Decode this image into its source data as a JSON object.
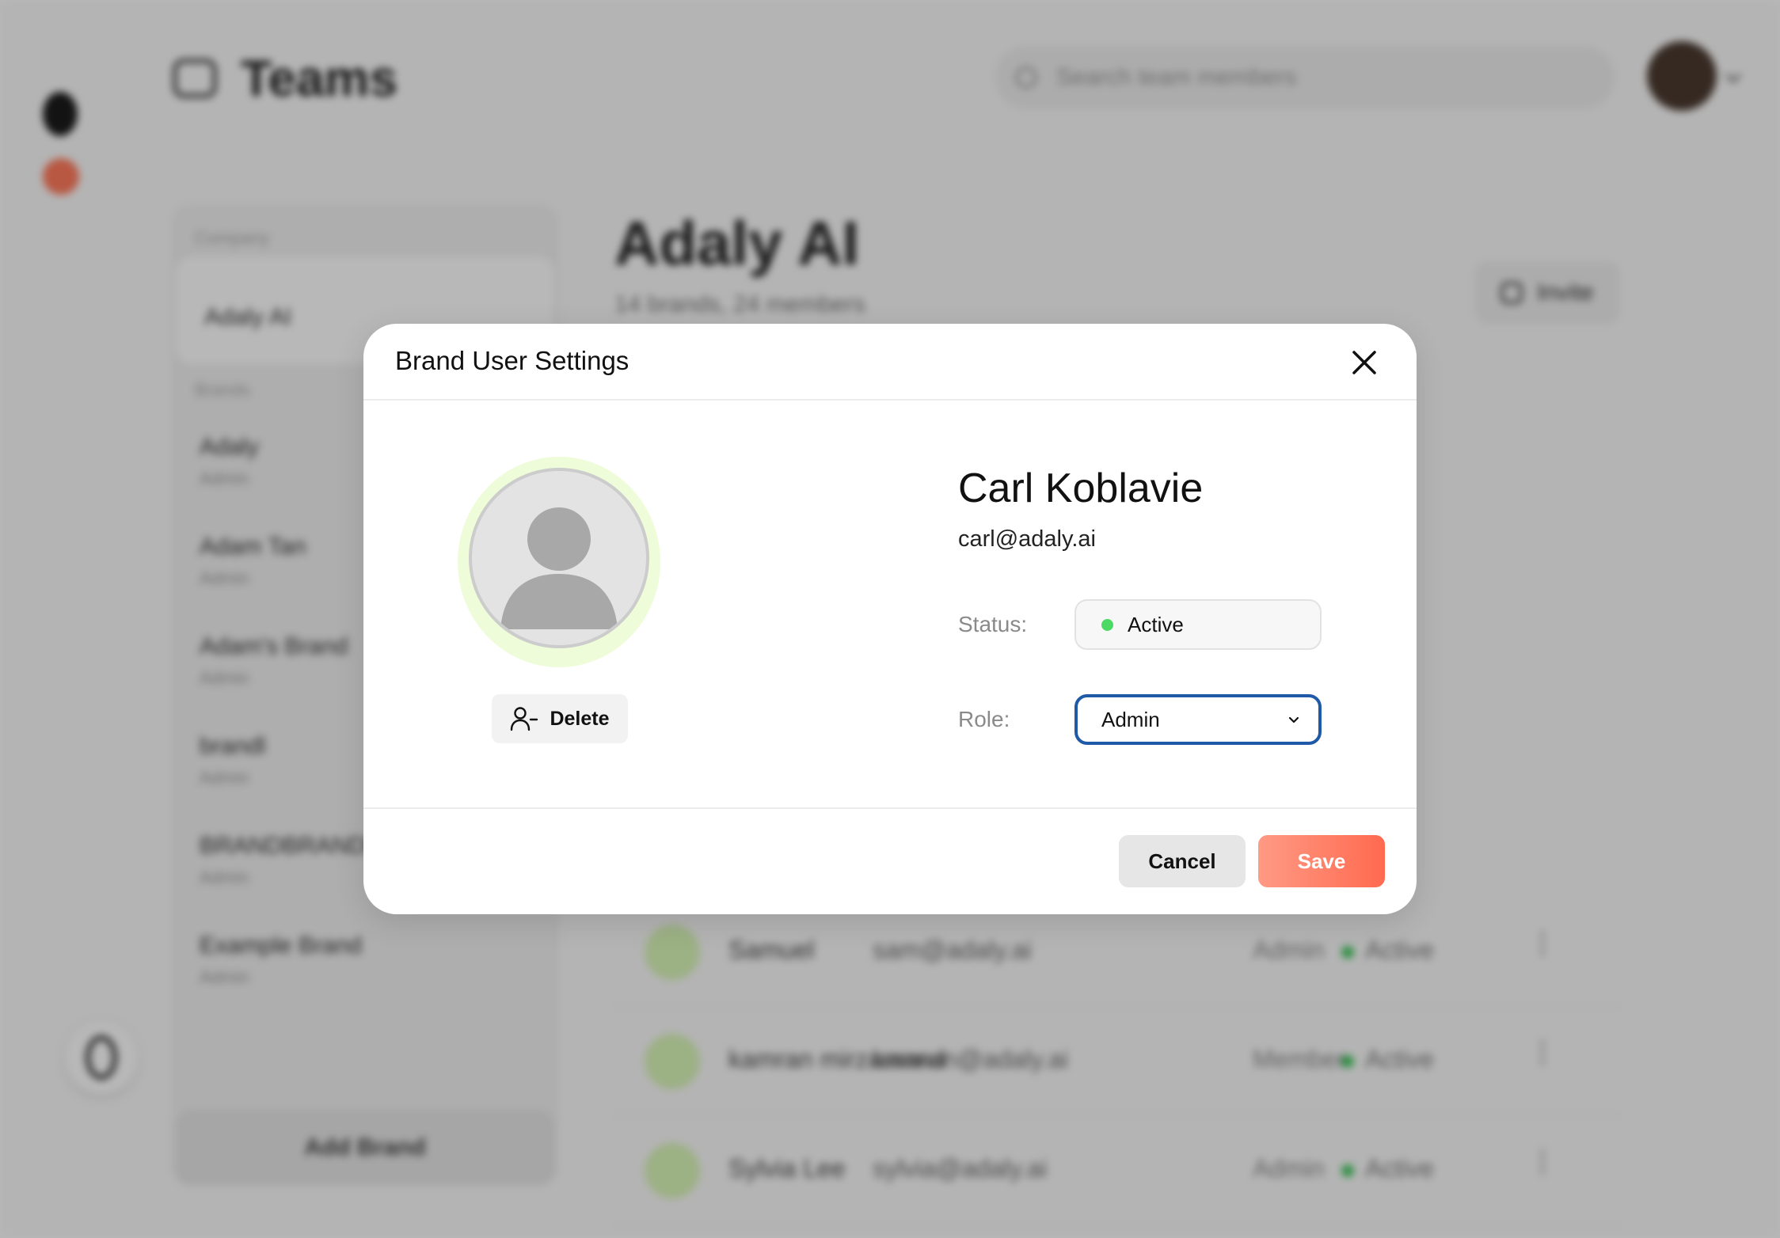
{
  "app": {
    "page_title": "Teams",
    "search_placeholder": "Search team members",
    "sidebar": {
      "company_label": "Company",
      "company_name": "Adaly AI",
      "brands_label": "Brands",
      "brands": [
        {
          "name": "Adaly",
          "role": "Admin"
        },
        {
          "name": "Adam Tan",
          "role": "Admin"
        },
        {
          "name": "Adam's Brand",
          "role": "Admin"
        },
        {
          "name": "brandl",
          "role": "Admin"
        },
        {
          "name": "BRANDBRANDB",
          "role": "Admin"
        },
        {
          "name": "Example Brand",
          "role": "Admin"
        }
      ],
      "add_brand_label": "Add Brand"
    },
    "main": {
      "title": "Adaly AI",
      "subtitle": "14 brands, 24 members",
      "invite_label": "Invite",
      "rows": [
        {
          "name": "Samuel",
          "email": "sam@adaly.ai",
          "role": "Admin",
          "status": "Active"
        },
        {
          "name": "kamran mirzamand",
          "email": "kamran@adaly.ai",
          "role": "Member",
          "status": "Active"
        },
        {
          "name": "Sylvia Lee",
          "email": "sylvia@adaly.ai",
          "role": "Admin",
          "status": "Active"
        }
      ]
    }
  },
  "modal": {
    "title": "Brand User Settings",
    "user": {
      "name": "Carl Koblavie",
      "email": "carl@adaly.ai"
    },
    "status_label": "Status:",
    "status_value": "Active",
    "role_label": "Role:",
    "role_value": "Admin",
    "delete_label": "Delete",
    "cancel_label": "Cancel",
    "save_label": "Save",
    "colors": {
      "accent": "#ff6a4f",
      "status_active": "#4cd964",
      "select_border": "#1f5aa8",
      "avatar_ring": "#eefcd9"
    },
    "icons": {
      "close": "close-icon",
      "delete": "user-minus-icon",
      "role_dropdown": "chevron-down-icon",
      "avatar": "user-placeholder-icon"
    }
  }
}
